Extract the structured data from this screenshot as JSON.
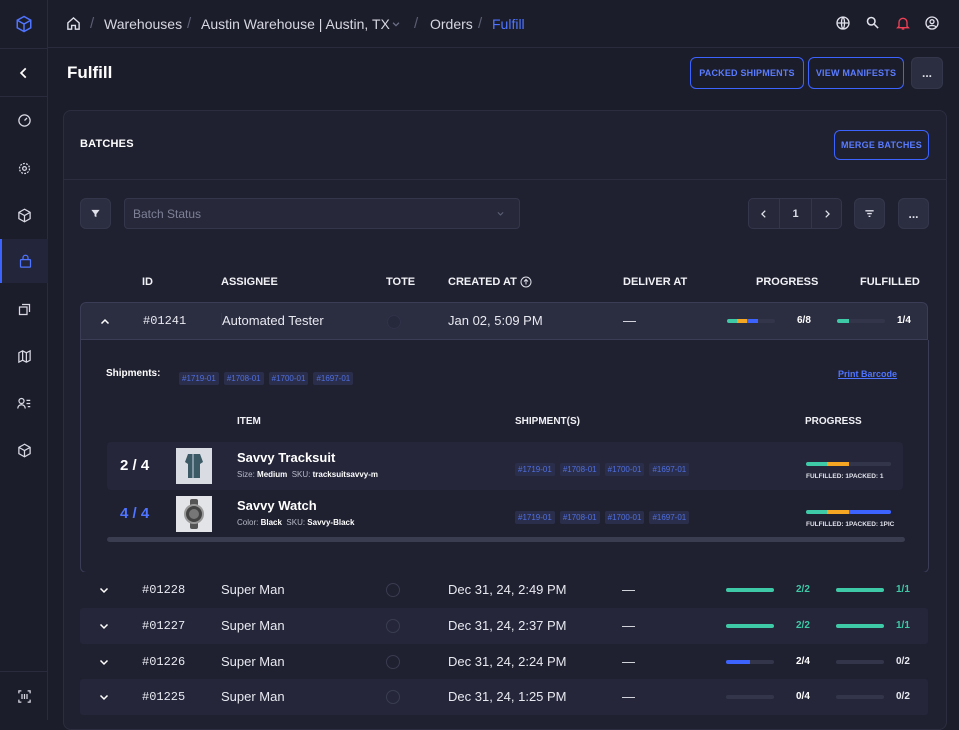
{
  "colors": {
    "accent": "#3d63ff",
    "teal": "#3ec9a7",
    "orange": "#f5a623",
    "blue": "#3d63ff",
    "bg": "#1c1d2b"
  },
  "breadcrumb": {
    "items": [
      "Warehouses",
      "Austin Warehouse | Austin, TX",
      "Orders"
    ],
    "current": "Fulfill"
  },
  "page": {
    "title": "Fulfill"
  },
  "actions": {
    "packed": "PACKED SHIPMENTS",
    "manifests": "VIEW MANIFESTS",
    "more": "..."
  },
  "batches": {
    "title": "BATCHES",
    "merge": "MERGE BATCHES",
    "filter_placeholder": "Batch Status",
    "page": "1",
    "columns": {
      "id": "ID",
      "assignee": "ASSIGNEE",
      "tote": "TOTE",
      "created": "CREATED AT",
      "deliver": "DELIVER AT",
      "progress": "PROGRESS",
      "fulfilled": "FULFILLED"
    },
    "expanded": {
      "id": "#01241",
      "assignee": "Automated Tester",
      "created": "Jan 02, 5:09 PM",
      "deliver": "—",
      "progress_text": "6/8",
      "fulfilled_text": "1/4",
      "progress_segments": [
        0.2,
        0.22,
        0.22
      ],
      "fulfilled_fraction": 0.25,
      "shipments_label": "Shipments:",
      "shipments": [
        "#1719-01",
        "#1708-01",
        "#1700-01",
        "#1697-01"
      ],
      "print": "Print Barcode",
      "columns": {
        "item": "ITEM",
        "shipments": "SHIPMENT(S)",
        "progress": "PROGRESS"
      },
      "items": [
        {
          "count": "2 / 4",
          "name": "Savvy Tracksuit",
          "attr_label": "Size:",
          "attr_value": "Medium",
          "sku_label": "SKU:",
          "sku": "tracksuitsavvy-m",
          "shipments": [
            "#1719-01",
            "#1708-01",
            "#1700-01",
            "#1697-01"
          ],
          "status": "FULFILLED: 1PACKED: 1",
          "segments": [
            0.25,
            0.25,
            0
          ]
        },
        {
          "count": "4 / 4",
          "name": "Savvy Watch",
          "attr_label": "Color:",
          "attr_value": "Black",
          "sku_label": "SKU:",
          "sku": "Savvy-Black",
          "shipments": [
            "#1719-01",
            "#1708-01",
            "#1700-01",
            "#1697-01"
          ],
          "status": "FULFILLED: 1PACKED: 1PIC",
          "segments": [
            0.25,
            0.25,
            0.5
          ]
        }
      ]
    },
    "rows": [
      {
        "id": "#01228",
        "assignee": "Super Man",
        "created": "Dec 31, 24, 2:49 PM",
        "deliver": "—",
        "progress_text": "2/2",
        "progress": 1,
        "progress_color": "#3ec9a7",
        "fulfilled_text": "1/1",
        "fulfilled": 1,
        "ratio_color": "#3ec9a7"
      },
      {
        "id": "#01227",
        "assignee": "Super Man",
        "created": "Dec 31, 24, 2:37 PM",
        "deliver": "—",
        "progress_text": "2/2",
        "progress": 1,
        "progress_color": "#3ec9a7",
        "fulfilled_text": "1/1",
        "fulfilled": 1,
        "ratio_color": "#3ec9a7"
      },
      {
        "id": "#01226",
        "assignee": "Super Man",
        "created": "Dec 31, 24, 2:24 PM",
        "deliver": "—",
        "progress_text": "2/4",
        "progress": 0.5,
        "progress_color": "#3d63ff",
        "fulfilled_text": "0/2",
        "fulfilled": 0,
        "ratio_color": "#e8e9f0"
      },
      {
        "id": "#01225",
        "assignee": "Super Man",
        "created": "Dec 31, 24, 1:25 PM",
        "deliver": "—",
        "progress_text": "0/4",
        "progress": 0,
        "progress_color": "#3d63ff",
        "fulfilled_text": "0/2",
        "fulfilled": 0,
        "ratio_color": "#e8e9f0"
      }
    ]
  }
}
